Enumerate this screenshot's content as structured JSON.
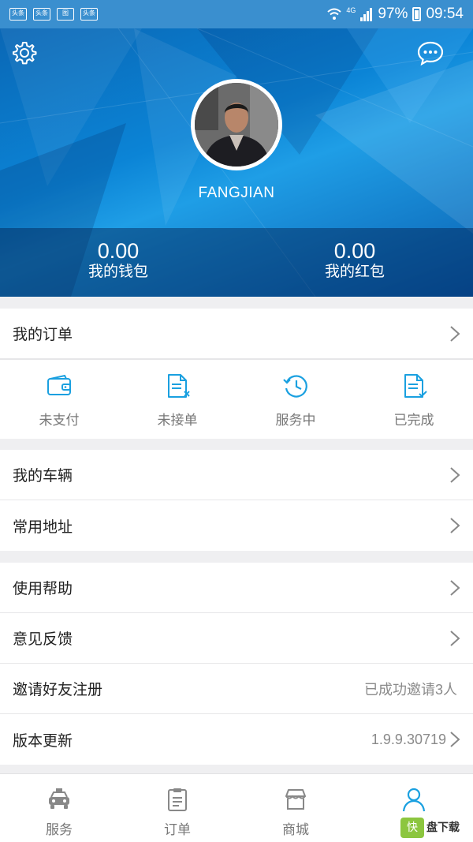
{
  "status_bar": {
    "app_icons": [
      "头条",
      "头条",
      "图",
      "头条"
    ],
    "network": "4G",
    "battery": "97%",
    "time": "09:54"
  },
  "profile": {
    "username": "FANGJIAN",
    "wallet": {
      "amount": "0.00",
      "label": "我的钱包"
    },
    "red_packet": {
      "amount": "0.00",
      "label": "我的红包"
    }
  },
  "orders": {
    "title": "我的订单",
    "statuses": [
      {
        "label": "未支付",
        "icon": "wallet-icon"
      },
      {
        "label": "未接单",
        "icon": "document-x-icon"
      },
      {
        "label": "服务中",
        "icon": "history-clock-icon"
      },
      {
        "label": "已完成",
        "icon": "document-check-icon"
      }
    ]
  },
  "group1": [
    {
      "label": "我的车辆"
    },
    {
      "label": "常用地址"
    }
  ],
  "group2": [
    {
      "label": "使用帮助",
      "value": ""
    },
    {
      "label": "意见反馈",
      "value": ""
    },
    {
      "label": "邀请好友注册",
      "value": "已成功邀请3人"
    },
    {
      "label": "版本更新",
      "value": "1.9.9.30719"
    }
  ],
  "bottom_nav": [
    {
      "label": "服务",
      "icon": "car-icon",
      "active": false
    },
    {
      "label": "订单",
      "icon": "clipboard-icon",
      "active": false
    },
    {
      "label": "商城",
      "icon": "store-icon",
      "active": false
    },
    {
      "label": "",
      "icon": "person-icon",
      "active": true
    }
  ],
  "watermark": {
    "mark": "快",
    "text": "盘下载"
  },
  "colors": {
    "accent": "#1aa0e0",
    "header": "#0b84d6",
    "status_bar": "#3a8fcf"
  }
}
